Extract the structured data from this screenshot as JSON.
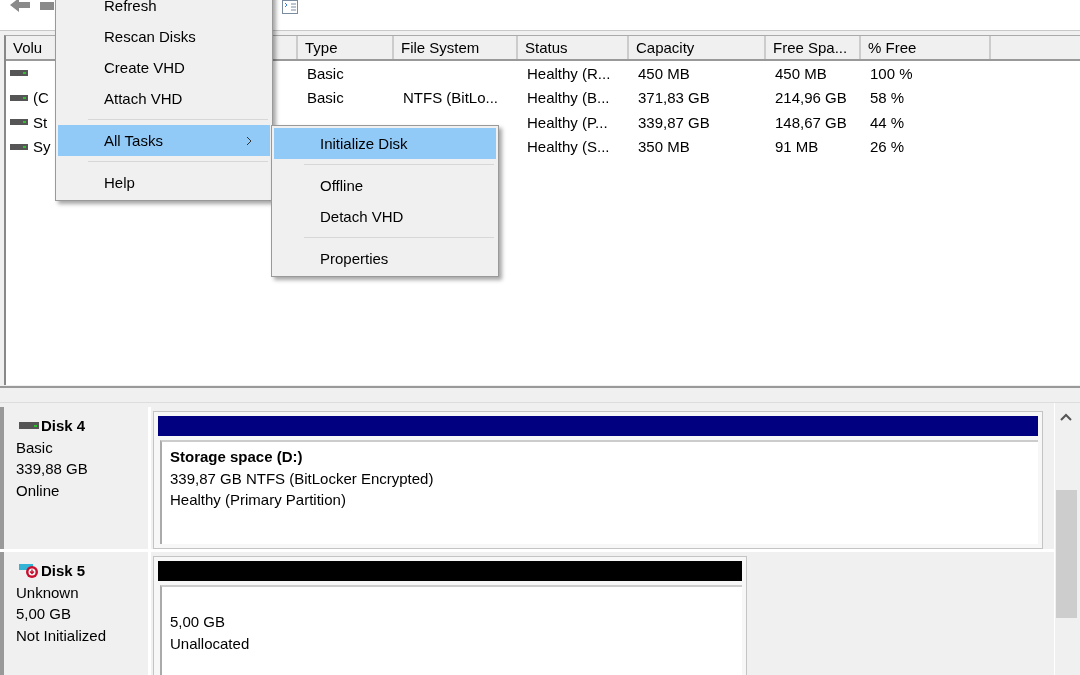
{
  "volume_list": {
    "columns": [
      "Volu",
      "Type",
      "File System",
      "Status",
      "Capacity",
      "Free Spa...",
      "% Free"
    ],
    "rows": [
      {
        "cells": [
          "",
          "Basic",
          "",
          "Healthy (R...",
          "450 MB",
          "450 MB",
          "100 %"
        ]
      },
      {
        "cells": [
          "(C",
          "Basic",
          "NTFS (BitLo...",
          "Healthy (B...",
          "371,83 GB",
          "214,96 GB",
          "58 %"
        ]
      },
      {
        "cells": [
          "St",
          "",
          "",
          "Healthy (P...",
          "339,87 GB",
          "148,67 GB",
          "44 %"
        ]
      },
      {
        "cells": [
          "Sy",
          "",
          "",
          "Healthy (S...",
          "350 MB",
          "91 MB",
          "26 %"
        ]
      }
    ]
  },
  "context_menu": {
    "items": [
      {
        "kind": "item",
        "label": "Refresh",
        "selected": false,
        "submenu": false
      },
      {
        "kind": "item",
        "label": "Rescan Disks",
        "selected": false,
        "submenu": false
      },
      {
        "kind": "item",
        "label": "Create VHD",
        "selected": false,
        "submenu": false
      },
      {
        "kind": "item",
        "label": "Attach VHD",
        "selected": false,
        "submenu": false
      },
      {
        "kind": "separator"
      },
      {
        "kind": "item",
        "label": "All Tasks",
        "selected": true,
        "submenu": true
      },
      {
        "kind": "separator"
      },
      {
        "kind": "item",
        "label": "Help",
        "selected": false,
        "submenu": false
      }
    ]
  },
  "submenu": {
    "items": [
      {
        "kind": "item",
        "label": "Initialize Disk",
        "selected": true
      },
      {
        "kind": "separator"
      },
      {
        "kind": "item",
        "label": "Offline",
        "selected": false
      },
      {
        "kind": "item",
        "label": "Detach VHD",
        "selected": false
      },
      {
        "kind": "separator"
      },
      {
        "kind": "item",
        "label": "Properties",
        "selected": false
      }
    ]
  },
  "disks": [
    {
      "name": "Disk 4",
      "error": false,
      "lines": [
        "Basic",
        "339,88 GB",
        "Online"
      ],
      "partitions": [
        {
          "kind": "primary",
          "title": "Storage space  (D:)",
          "lines": [
            "339,87 GB NTFS (BitLocker Encrypted)",
            "Healthy (Primary Partition)"
          ]
        }
      ]
    },
    {
      "name": "Disk 5",
      "error": true,
      "lines": [
        "Unknown",
        "5,00 GB",
        "Not Initialized"
      ],
      "partitions": [
        {
          "kind": "unallocated",
          "lines": [
            "5,00 GB",
            "Unallocated"
          ]
        }
      ]
    }
  ]
}
